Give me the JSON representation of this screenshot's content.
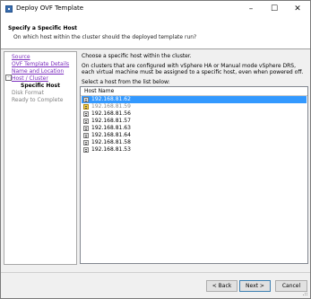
{
  "window": {
    "title": "Deploy OVF Template"
  },
  "header": {
    "title": "Specify a Specific Host",
    "subtitle": "On which host within the cluster should the deployed template run?"
  },
  "steps": [
    {
      "label": "Source",
      "state": "link"
    },
    {
      "label": "OVF Template Details",
      "state": "link"
    },
    {
      "label": "Name and Location",
      "state": "link"
    },
    {
      "label": "Host / Cluster",
      "state": "link"
    },
    {
      "label": "Specific Host",
      "state": "current"
    },
    {
      "label": "Disk Format",
      "state": "disabled"
    },
    {
      "label": "Ready to Complete",
      "state": "disabled"
    }
  ],
  "content": {
    "instruction": "Choose a specific host within the cluster.",
    "description": "On clusters that are configured with vSphere HA or Manual mode vSphere DRS, each virtual machine must be assigned to a specific host, even when powered off.",
    "list_prompt": "Select a host from the list below:",
    "column_header": "Host Name",
    "hosts": [
      {
        "name": "192.168.81.62",
        "icon": "host-icon",
        "selected": true
      },
      {
        "name": "192.168.81.59",
        "icon": "host-warning-icon",
        "dimmed": true
      },
      {
        "name": "192.168.81.56",
        "icon": "host-icon"
      },
      {
        "name": "192.168.81.57",
        "icon": "host-icon"
      },
      {
        "name": "192.168.81.63",
        "icon": "host-icon"
      },
      {
        "name": "192.168.81.64",
        "icon": "host-icon"
      },
      {
        "name": "192.168.81.58",
        "icon": "host-icon"
      },
      {
        "name": "192.168.81.53",
        "icon": "host-icon"
      }
    ]
  },
  "buttons": {
    "back": "< Back",
    "next": "Next >",
    "cancel": "Cancel"
  }
}
